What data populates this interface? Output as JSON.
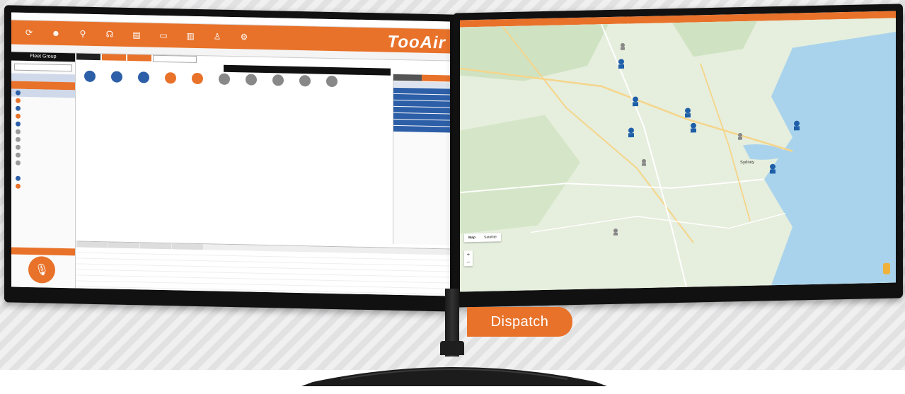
{
  "badge": {
    "label": "Dispatch"
  },
  "left_app": {
    "brand": "TooAir",
    "colors": {
      "accent": "#e8722a",
      "selection": "#2d5fa8"
    },
    "sidebar": {
      "header": "Fleet Group"
    },
    "toolbar_icons": [
      "refresh-icon",
      "users-icon",
      "location-icon",
      "headset-icon",
      "document-icon",
      "monitor-icon",
      "document-icon",
      "users-icon",
      "gear-icon"
    ]
  },
  "right_app": {
    "map": {
      "toggle": {
        "map_label": "Map",
        "satellite_label": "Satellite"
      },
      "zoom_in": "+",
      "zoom_out": "−",
      "city": "Sydney"
    }
  }
}
